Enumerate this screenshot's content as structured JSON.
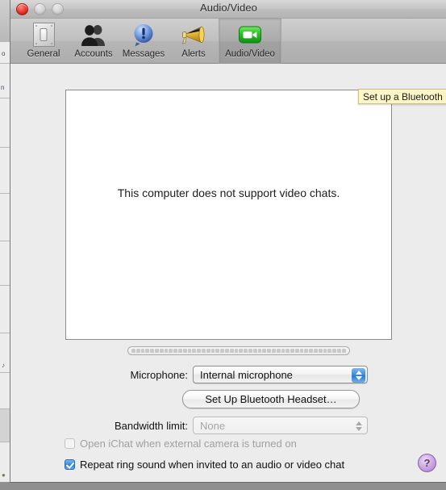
{
  "window": {
    "title": "Audio/Video",
    "controls": {
      "close": "close-button",
      "minimize": "minimize-button",
      "zoom": "zoom-button"
    }
  },
  "toolbar": {
    "items": [
      {
        "label": "General",
        "icon": "switch-plate-icon",
        "selected": false
      },
      {
        "label": "Accounts",
        "icon": "two-people-icon",
        "selected": false
      },
      {
        "label": "Messages",
        "icon": "speech-bubble-icon",
        "selected": false
      },
      {
        "label": "Alerts",
        "icon": "megaphone-icon",
        "selected": false
      },
      {
        "label": "Audio/Video",
        "icon": "video-camera-icon",
        "selected": true
      }
    ]
  },
  "video_preview": {
    "message_line1": "This computer does not support video",
    "message_line2": "chats."
  },
  "tooltip": {
    "text": "Set up a Bluetooth headset"
  },
  "level_meter": {
    "name": "audio-level-meter",
    "segments": 46,
    "active_segments": 0
  },
  "form": {
    "microphone": {
      "label": "Microphone:",
      "value": "Internal microphone",
      "enabled": true
    },
    "bluetooth_button": {
      "label": "Set Up Bluetooth Headset…",
      "enabled": true
    },
    "bandwidth": {
      "label": "Bandwidth limit:",
      "value": "None",
      "enabled": false
    },
    "checkboxes": [
      {
        "label": "Open iChat when external camera is turned on",
        "checked": false,
        "enabled": false
      },
      {
        "label": "Repeat ring sound when invited to an audio or video chat",
        "checked": true,
        "enabled": true
      }
    ]
  },
  "help": {
    "glyph": "?"
  },
  "colors": {
    "window_background": "#ececec",
    "toolbar_top": "#cfcfcf",
    "accent_blue": "#3f8ddb",
    "tooltip_background": "#fcf5c7",
    "help_purple": "#a87ec9",
    "video_camera_green": "#27c12b"
  }
}
